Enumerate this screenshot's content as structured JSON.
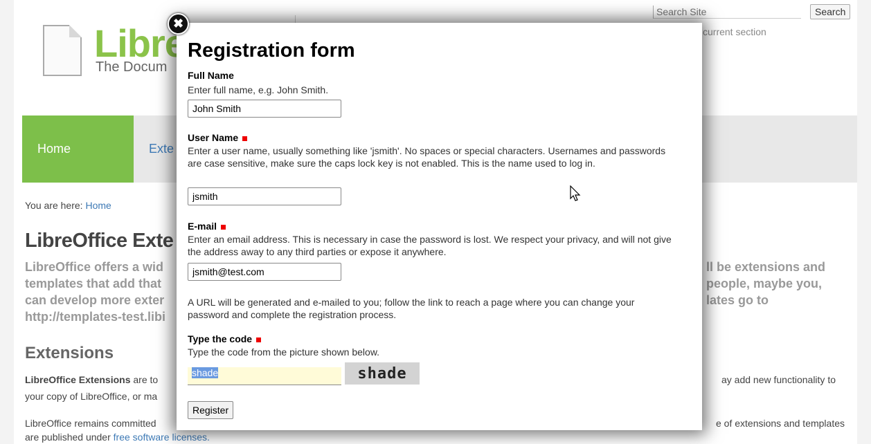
{
  "header": {
    "search_placeholder": "Search Site",
    "search_button": "Search",
    "section_text": "current section",
    "logo_name": "Libre",
    "logo_tagline": "The Docum"
  },
  "nav": {
    "home": "Home",
    "extensions_partial": "Exte"
  },
  "breadcrumb": {
    "prefix": "You are here:",
    "link": "Home"
  },
  "content": {
    "page_title": "LibreOffice Exte",
    "intro_left": [
      "LibreOffice offers a wid",
      "templates that add that",
      "can develop more exter",
      "http://templates-test.libi"
    ],
    "intro_right": [
      "ll be extensions and",
      "people, maybe you,",
      "lates go to"
    ],
    "section_title": "Extensions",
    "para1_left_bold": "LibreOffice Extensions",
    "para1_left_rest": " are to",
    "para1_left_line2": "your copy of LibreOffice, or ma",
    "para1_right": "ay add new functionality to",
    "para2_left": "LibreOffice remains committed",
    "para2_right": "e of extensions and templates",
    "para2_line2_prefix": "are published under ",
    "para2_line2_link": "free software licenses."
  },
  "modal": {
    "title": "Registration form",
    "full_name": {
      "label": "Full Name",
      "help": "Enter full name, e.g. John Smith.",
      "value": "John Smith"
    },
    "user_name": {
      "label": "User Name",
      "help": "Enter a user name, usually something like 'jsmith'. No spaces or special characters. Usernames and passwords are case sensitive, make sure the caps lock key is not enabled. This is the name used to log in.",
      "value": "jsmith"
    },
    "email": {
      "label": "E-mail",
      "help": "Enter an email address. This is necessary in case the password is lost. We respect your privacy, and will not give the address away to any third parties or expose it anywhere.",
      "value": "jsmith@test.com"
    },
    "url_note": "A URL will be generated and e-mailed to you; follow the link to reach a page where you can change your password and complete the registration process.",
    "captcha": {
      "label": "Type the code",
      "help": "Type the code from the picture shown below.",
      "value": "shade",
      "image_text": "shade"
    },
    "register_button": "Register",
    "close_icon": "✖"
  },
  "colors": {
    "accent_green": "#7dbf4a",
    "required_red": "#e00000",
    "link_blue": "#3d79b5"
  }
}
